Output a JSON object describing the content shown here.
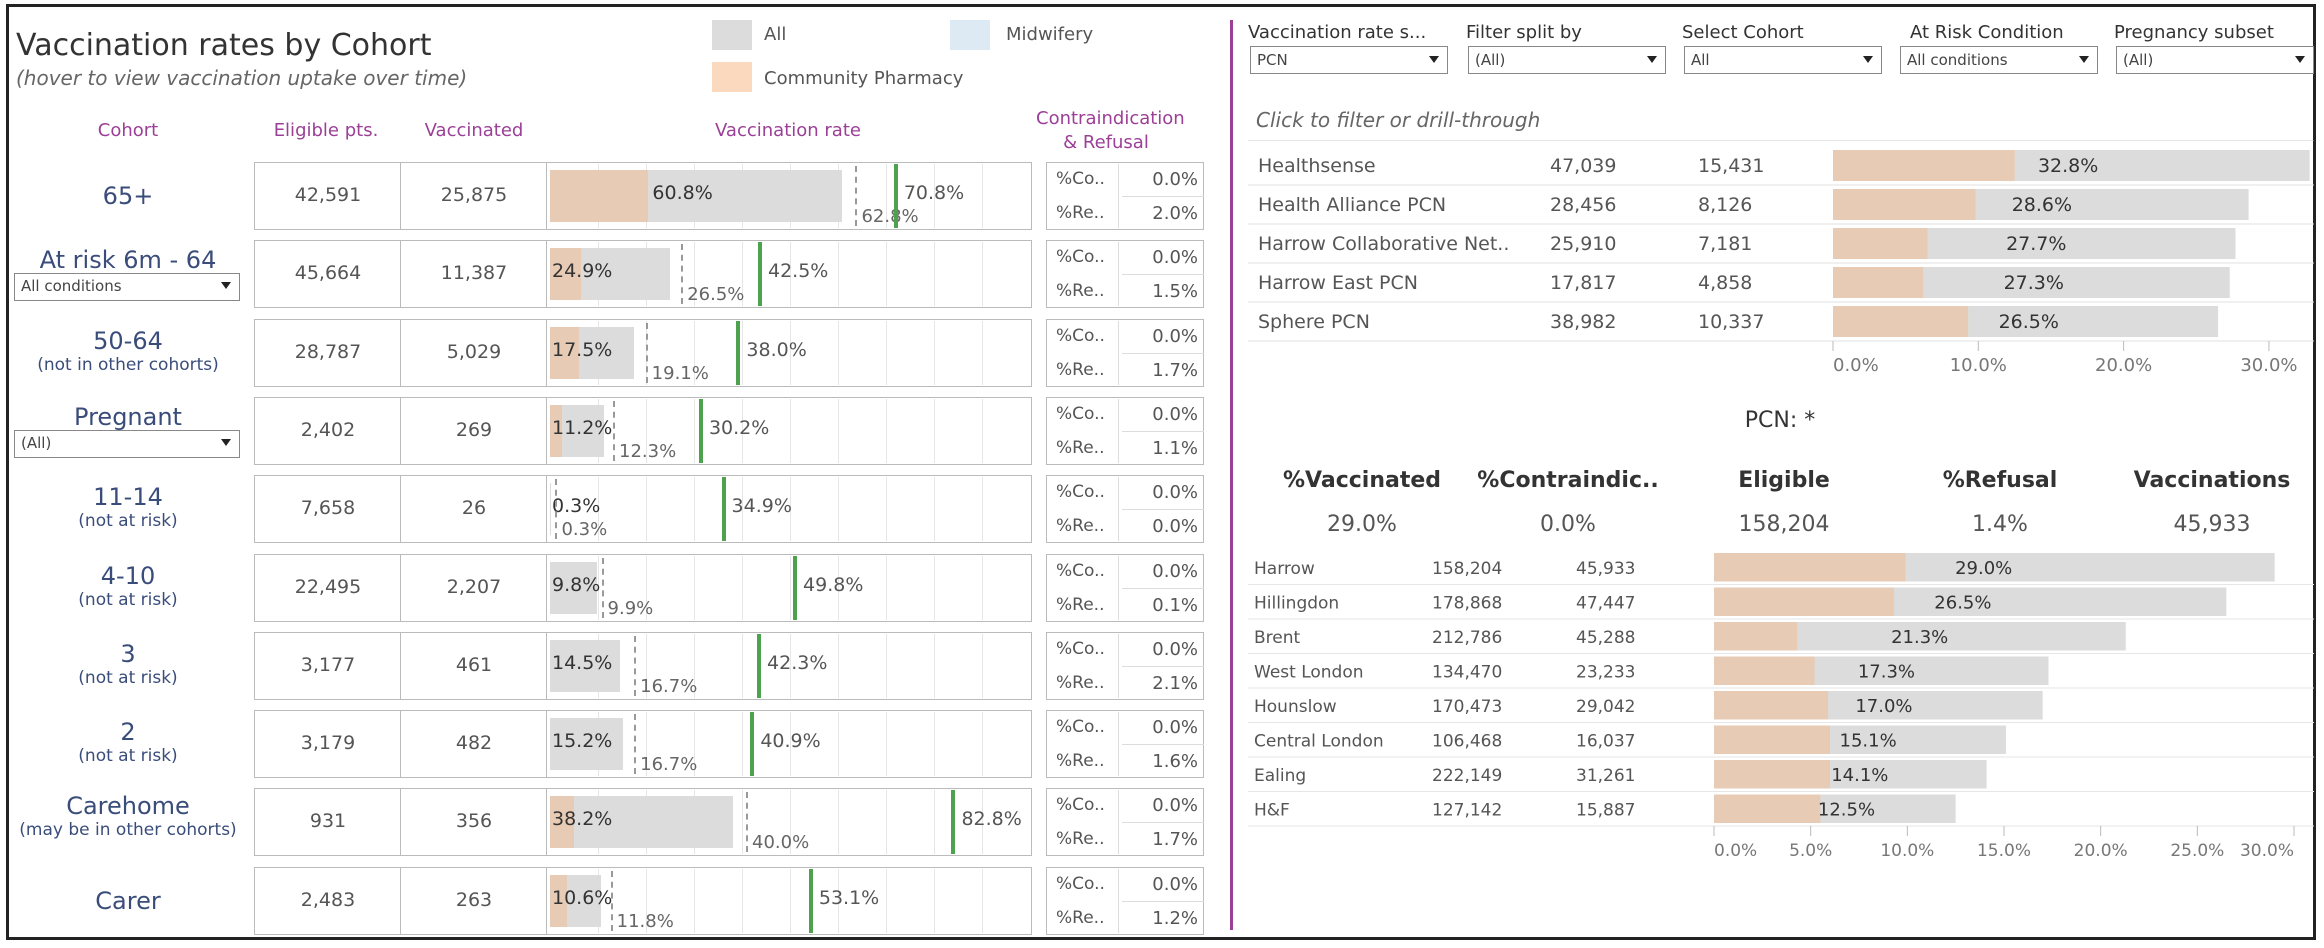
{
  "header": {
    "title": "Vaccination rates by Cohort",
    "subtitle": "(hover to view vaccination uptake over time)"
  },
  "legend": [
    {
      "label": "All",
      "color": "#dcdcdc"
    },
    {
      "label": "Midwifery",
      "color": "#dde9f3"
    },
    {
      "label": "Community Pharmacy",
      "color": "#fbd9bf"
    }
  ],
  "colors": {
    "all": "#dcdcdc",
    "pharmacy": "#e7cbb5",
    "target": "#4da24d",
    "accent": "#9b3f97"
  },
  "columns": {
    "cohort": "Cohort",
    "eligible": "Eligible pts.",
    "vaccinated": "Vaccinated",
    "rate": "Vaccination rate",
    "contra_line1": "Contraindication",
    "contra_line2": "& Refusal"
  },
  "cohort_dropdowns": {
    "at_risk": "All conditions",
    "pregnant": "(All)"
  },
  "filters": [
    {
      "label": "Vaccination rate s...",
      "value": "PCN"
    },
    {
      "label": "Filter split by",
      "value": "(All)"
    },
    {
      "label": "Select Cohort",
      "value": "All"
    },
    {
      "label": "At Risk Condition",
      "value": "All conditions"
    },
    {
      "label": "Pregnancy subset",
      "value": "(All)"
    }
  ],
  "pcn_hint": "Click to filter or drill-through",
  "kpi": {
    "title": "PCN: *",
    "items": [
      {
        "label": "%Vaccinated",
        "value": "29.0%"
      },
      {
        "label": "%Contraindic..",
        "value": "0.0%"
      },
      {
        "label": "Eligible",
        "value": "158,204"
      },
      {
        "label": "%Refusal",
        "value": "1.4%"
      },
      {
        "label": "Vaccinations",
        "value": "45,933"
      }
    ]
  },
  "chart_data": [
    {
      "type": "bar",
      "title": "Vaccination rates by Cohort",
      "xlim": [
        0,
        100
      ],
      "columns": [
        "Cohort",
        "Eligible pts.",
        "Vaccinated",
        "Vaccination rate",
        "Contraindication & Refusal"
      ],
      "rows": [
        {
          "cohort": "65+",
          "sub": "",
          "eligible": "42,591",
          "vaccinated": "25,875",
          "rate": 60.8,
          "rate_label": "60.8%",
          "pharmacy": 20.5,
          "reference": 62.8,
          "reference_label": "62.8%",
          "target": 70.8,
          "target_label": "70.8%",
          "contra": "0.0%",
          "refusal": "2.0%"
        },
        {
          "cohort": "At risk 6m - 64",
          "sub": "",
          "eligible": "45,664",
          "vaccinated": "11,387",
          "rate": 24.9,
          "rate_label": "24.9%",
          "pharmacy": 6.5,
          "reference": 26.5,
          "reference_label": "26.5%",
          "target": 42.5,
          "target_label": "42.5%",
          "contra": "0.0%",
          "refusal": "1.5%"
        },
        {
          "cohort": "50-64",
          "sub": "(not in other cohorts)",
          "eligible": "28,787",
          "vaccinated": "5,029",
          "rate": 17.5,
          "rate_label": "17.5%",
          "pharmacy": 6.0,
          "reference": 19.1,
          "reference_label": "19.1%",
          "target": 38.0,
          "target_label": "38.0%",
          "contra": "0.0%",
          "refusal": "1.7%"
        },
        {
          "cohort": "Pregnant",
          "sub": "",
          "eligible": "2,402",
          "vaccinated": "269",
          "rate": 11.2,
          "rate_label": "11.2%",
          "pharmacy": 2.5,
          "reference": 12.3,
          "reference_label": "12.3%",
          "target": 30.2,
          "target_label": "30.2%",
          "contra": "0.0%",
          "refusal": "1.1%"
        },
        {
          "cohort": "11-14",
          "sub": "(not at risk)",
          "eligible": "7,658",
          "vaccinated": "26",
          "rate": 0.3,
          "rate_label": "0.3%",
          "pharmacy": 0.0,
          "reference": 0.3,
          "reference_label": "0.3%",
          "target": 34.9,
          "target_label": "34.9%",
          "contra": "0.0%",
          "refusal": "0.0%"
        },
        {
          "cohort": "4-10",
          "sub": "(not at risk)",
          "eligible": "22,495",
          "vaccinated": "2,207",
          "rate": 9.8,
          "rate_label": "9.8%",
          "pharmacy": 0.0,
          "reference": 9.9,
          "reference_label": "9.9%",
          "target": 49.8,
          "target_label": "49.8%",
          "contra": "0.0%",
          "refusal": "0.1%"
        },
        {
          "cohort": "3",
          "sub": "(not at risk)",
          "eligible": "3,177",
          "vaccinated": "461",
          "rate": 14.5,
          "rate_label": "14.5%",
          "pharmacy": 0.0,
          "reference": 16.7,
          "reference_label": "16.7%",
          "target": 42.3,
          "target_label": "42.3%",
          "contra": "0.0%",
          "refusal": "2.1%"
        },
        {
          "cohort": "2",
          "sub": "(not at risk)",
          "eligible": "3,179",
          "vaccinated": "482",
          "rate": 15.2,
          "rate_label": "15.2%",
          "pharmacy": 0.0,
          "reference": 16.7,
          "reference_label": "16.7%",
          "target": 40.9,
          "target_label": "40.9%",
          "contra": "0.0%",
          "refusal": "1.6%"
        },
        {
          "cohort": "Carehome",
          "sub": "(may be in other cohorts)",
          "eligible": "931",
          "vaccinated": "356",
          "rate": 38.2,
          "rate_label": "38.2%",
          "pharmacy": 5.0,
          "reference": 40.0,
          "reference_label": "40.0%",
          "target": 82.8,
          "target_label": "82.8%",
          "contra": "0.0%",
          "refusal": "1.7%"
        },
        {
          "cohort": "Carer",
          "sub": "",
          "eligible": "2,483",
          "vaccinated": "263",
          "rate": 10.6,
          "rate_label": "10.6%",
          "pharmacy": 3.5,
          "reference": 11.8,
          "reference_label": "11.8%",
          "target": 53.1,
          "target_label": "53.1%",
          "contra": "0.0%",
          "refusal": "1.2%"
        }
      ],
      "contra_prefix": "%Co..",
      "refusal_prefix": "%Re.."
    },
    {
      "type": "bar",
      "xlim": [
        0,
        32
      ],
      "ticks": [
        "0.0%",
        "10.0%",
        "20.0%",
        "30.0%"
      ],
      "tick_values": [
        0,
        10,
        20,
        30
      ],
      "rows": [
        {
          "name": "Healthsense",
          "eligible": "47,039",
          "vaccinated": "15,431",
          "rate": 32.8,
          "rate_label": "32.8%",
          "pharmacy": 12.5
        },
        {
          "name": "Health Alliance PCN",
          "eligible": "28,456",
          "vaccinated": "8,126",
          "rate": 28.6,
          "rate_label": "28.6%",
          "pharmacy": 9.8
        },
        {
          "name": "Harrow Collaborative Net..",
          "eligible": "25,910",
          "vaccinated": "7,181",
          "rate": 27.7,
          "rate_label": "27.7%",
          "pharmacy": 6.5
        },
        {
          "name": "Harrow East PCN",
          "eligible": "17,817",
          "vaccinated": "4,858",
          "rate": 27.3,
          "rate_label": "27.3%",
          "pharmacy": 6.2
        },
        {
          "name": "Sphere PCN",
          "eligible": "38,982",
          "vaccinated": "10,337",
          "rate": 26.5,
          "rate_label": "26.5%",
          "pharmacy": 9.3
        }
      ]
    },
    {
      "type": "bar",
      "xlim": [
        0,
        30
      ],
      "ticks": [
        "0.0%",
        "5.0%",
        "10.0%",
        "15.0%",
        "20.0%",
        "25.0%",
        "30.0%"
      ],
      "tick_values": [
        0,
        5,
        10,
        15,
        20,
        25,
        30
      ],
      "rows": [
        {
          "name": "Harrow",
          "eligible": "158,204",
          "vaccinated": "45,933",
          "rate": 29.0,
          "rate_label": "29.0%",
          "pharmacy": 9.9
        },
        {
          "name": "Hillingdon",
          "eligible": "178,868",
          "vaccinated": "47,447",
          "rate": 26.5,
          "rate_label": "26.5%",
          "pharmacy": 9.3
        },
        {
          "name": "Brent",
          "eligible": "212,786",
          "vaccinated": "45,288",
          "rate": 21.3,
          "rate_label": "21.3%",
          "pharmacy": 4.3
        },
        {
          "name": "West London",
          "eligible": "134,470",
          "vaccinated": "23,233",
          "rate": 17.3,
          "rate_label": "17.3%",
          "pharmacy": 5.2
        },
        {
          "name": "Hounslow",
          "eligible": "170,473",
          "vaccinated": "29,042",
          "rate": 17.0,
          "rate_label": "17.0%",
          "pharmacy": 5.9
        },
        {
          "name": "Central London",
          "eligible": "106,468",
          "vaccinated": "16,037",
          "rate": 15.1,
          "rate_label": "15.1%",
          "pharmacy": 6.0
        },
        {
          "name": "Ealing",
          "eligible": "222,149",
          "vaccinated": "31,261",
          "rate": 14.1,
          "rate_label": "14.1%",
          "pharmacy": 6.0
        },
        {
          "name": "H&F",
          "eligible": "127,142",
          "vaccinated": "15,887",
          "rate": 12.5,
          "rate_label": "12.5%",
          "pharmacy": 5.5
        }
      ]
    }
  ]
}
